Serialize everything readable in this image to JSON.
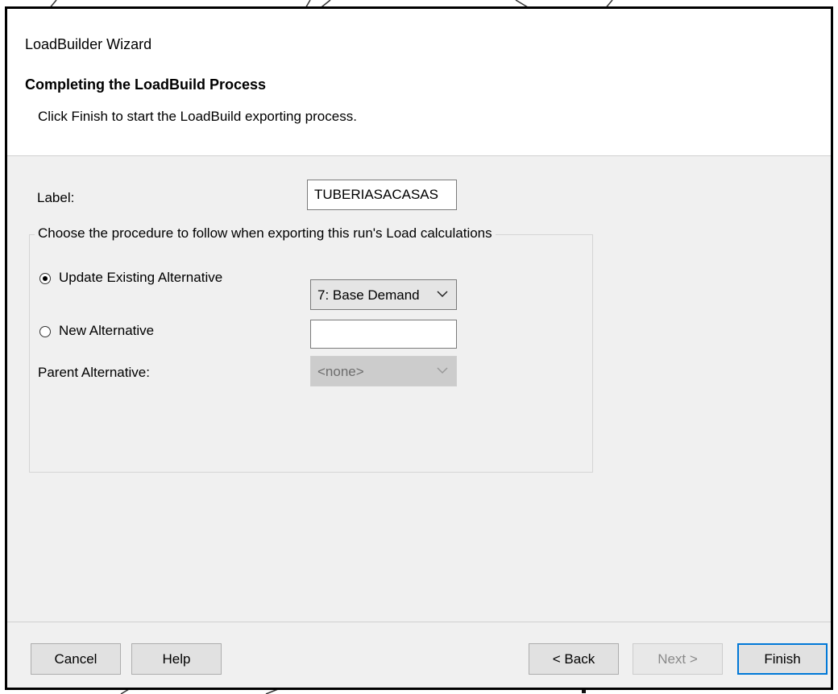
{
  "window": {
    "title": "LoadBuilder Wizard"
  },
  "header": {
    "heading": "Completing the LoadBuild Process",
    "subtitle": "Click Finish to start the LoadBuild exporting process."
  },
  "form": {
    "label_caption": "Label:",
    "label_value": "TUBERIASACASAS",
    "group_caption": "Choose the procedure to follow when exporting this run's Load calculations",
    "options": [
      {
        "label": "Update Existing Alternative",
        "selected": true
      },
      {
        "label": "New Alternative",
        "selected": false
      }
    ],
    "existing_alternative_value": "7: Base Demand",
    "new_alternative_value": "",
    "parent_alternative_caption": "Parent Alternative:",
    "parent_alternative_value": "<none>"
  },
  "buttons": {
    "cancel": "Cancel",
    "help": "Help",
    "back": "< Back",
    "next": "Next >",
    "finish": "Finish"
  },
  "colors": {
    "accent": "#0078d7",
    "dialog_bg": "#f0f0f0"
  }
}
